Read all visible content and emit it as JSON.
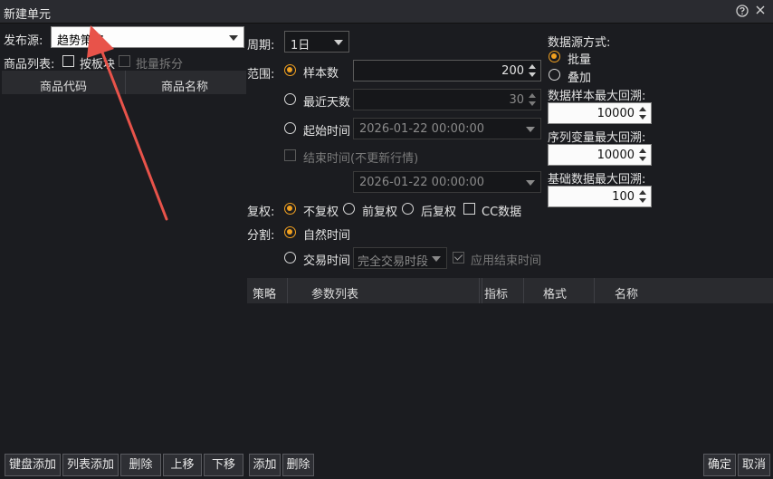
{
  "window": {
    "title": "新建单元"
  },
  "left": {
    "publish_label": "发布源:",
    "publish_value": "趋势策略",
    "products_label": "商品列表:",
    "by_block_label": "按板块",
    "batch_split_label": "批量拆分",
    "columns": [
      "商品代码",
      "商品名称"
    ]
  },
  "period": {
    "label": "周期:",
    "value": "1日"
  },
  "range": {
    "label": "范围:",
    "sample_count_label": "样本数",
    "sample_count_value": "200",
    "recent_days_label": "最近天数",
    "recent_days_value": "30",
    "start_time_label": "起始时间",
    "start_time_value": "2026-01-22 00:00:00",
    "end_time_label": "结束时间(不更新行情)",
    "end_time_value": "2026-01-22 00:00:00"
  },
  "datasource": {
    "label": "数据源方式:",
    "batch_label": "批量",
    "overlay_label": "叠加",
    "max_sample_label": "数据样本最大回溯:",
    "max_sample_value": "10000",
    "max_seq_label": "序列变量最大回溯:",
    "max_seq_value": "10000",
    "max_base_label": "基础数据最大回溯:",
    "max_base_value": "100"
  },
  "adjust": {
    "label": "复权:",
    "none_label": "不复权",
    "pre_label": "前复权",
    "post_label": "后复权",
    "cc_label": "CC数据"
  },
  "split": {
    "label": "分割:",
    "natural_label": "自然时间",
    "trade_label": "交易时间",
    "trade_value": "完全交易时段",
    "apply_end_label": "应用结束时间"
  },
  "strategy_table": {
    "columns": [
      "策略",
      "参数列表",
      "指标",
      "格式",
      "名称"
    ]
  },
  "buttons": {
    "keyboard_add": "键盘添加",
    "list_add": "列表添加",
    "delete_left": "删除",
    "move_up": "上移",
    "move_down": "下移",
    "add": "添加",
    "delete_right": "删除",
    "ok": "确定",
    "cancel": "取消"
  },
  "colors": {
    "accent": "#f0a020",
    "annotation_arrow": "#e8534a"
  },
  "icons": {
    "help": "help-icon",
    "close": "close-icon"
  }
}
